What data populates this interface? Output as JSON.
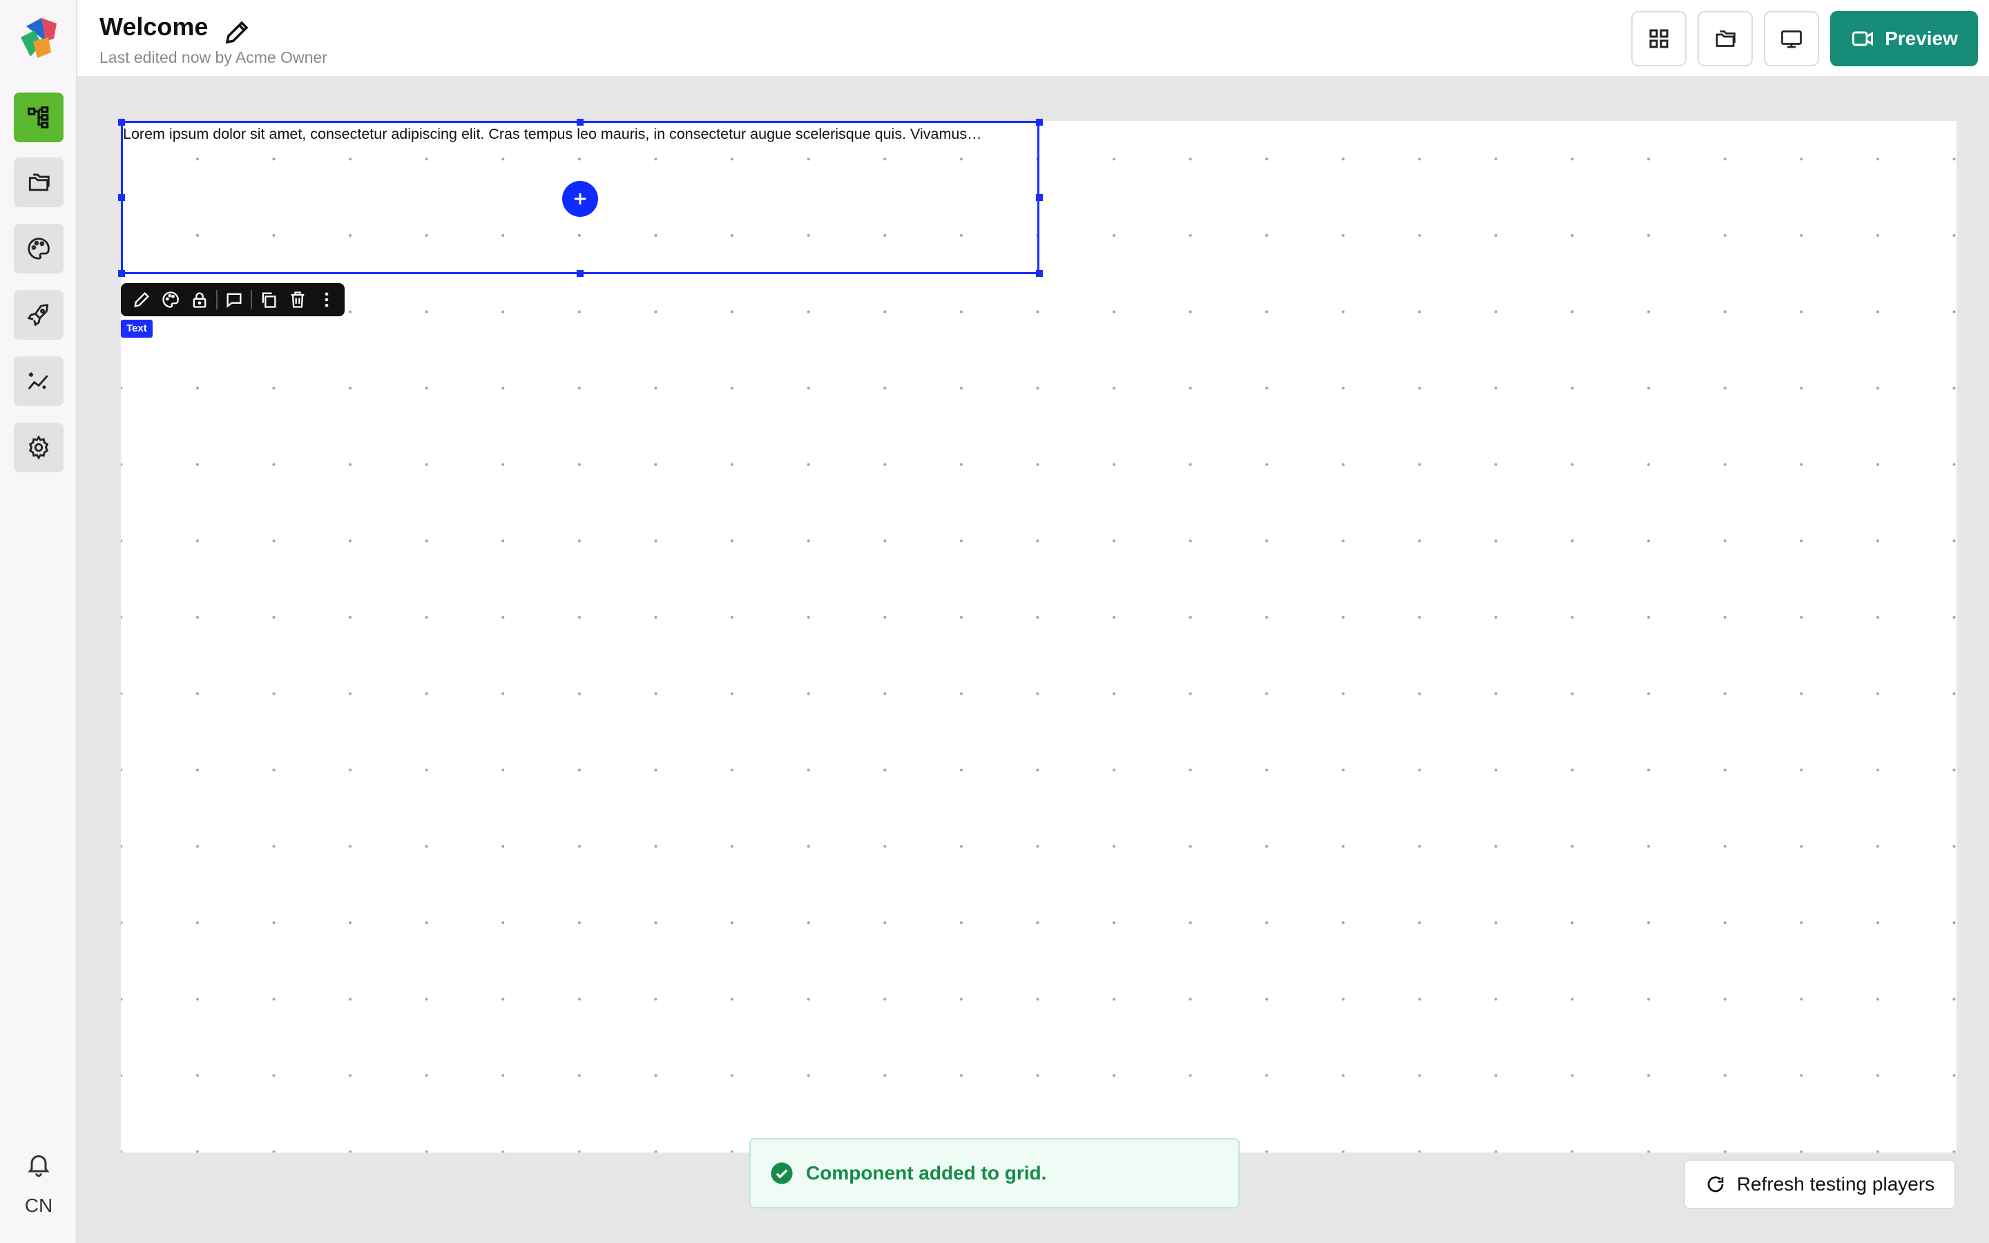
{
  "header": {
    "title": "Welcome",
    "subtitle": "Last edited now by Acme Owner",
    "preview_label": "Preview",
    "icons": [
      "grid-icon",
      "folders-icon",
      "monitor-icon",
      "video-icon"
    ]
  },
  "sidebar": {
    "items": [
      {
        "name": "structure",
        "icon": "hierarchy-icon",
        "active": true
      },
      {
        "name": "files",
        "icon": "folders-icon"
      },
      {
        "name": "themes",
        "icon": "palette-icon"
      },
      {
        "name": "publish",
        "icon": "rocket-icon"
      },
      {
        "name": "analytics",
        "icon": "sparkle-chart-icon"
      },
      {
        "name": "settings",
        "icon": "gear-icon"
      }
    ],
    "user_initials": "CN"
  },
  "canvas": {
    "text_component": "Lorem ipsum dolor sit amet, consectetur adipiscing elit. Cras tempus leo mauris, in consectetur augue scelerisque quis. Vivamus…",
    "component_type": "Text",
    "toolbar_tools": [
      "edit-icon",
      "palette-icon",
      "lock-icon",
      "comment-icon",
      "duplicate-icon",
      "trash-icon",
      "more-icon"
    ]
  },
  "toast": {
    "message": "Component added to grid."
  },
  "refresh_label": "Refresh testing players",
  "colors": {
    "accent_green": "#5cb82f",
    "preview_teal": "#178c78",
    "selection_blue": "#1a2dff",
    "toast_green": "#168a48"
  }
}
